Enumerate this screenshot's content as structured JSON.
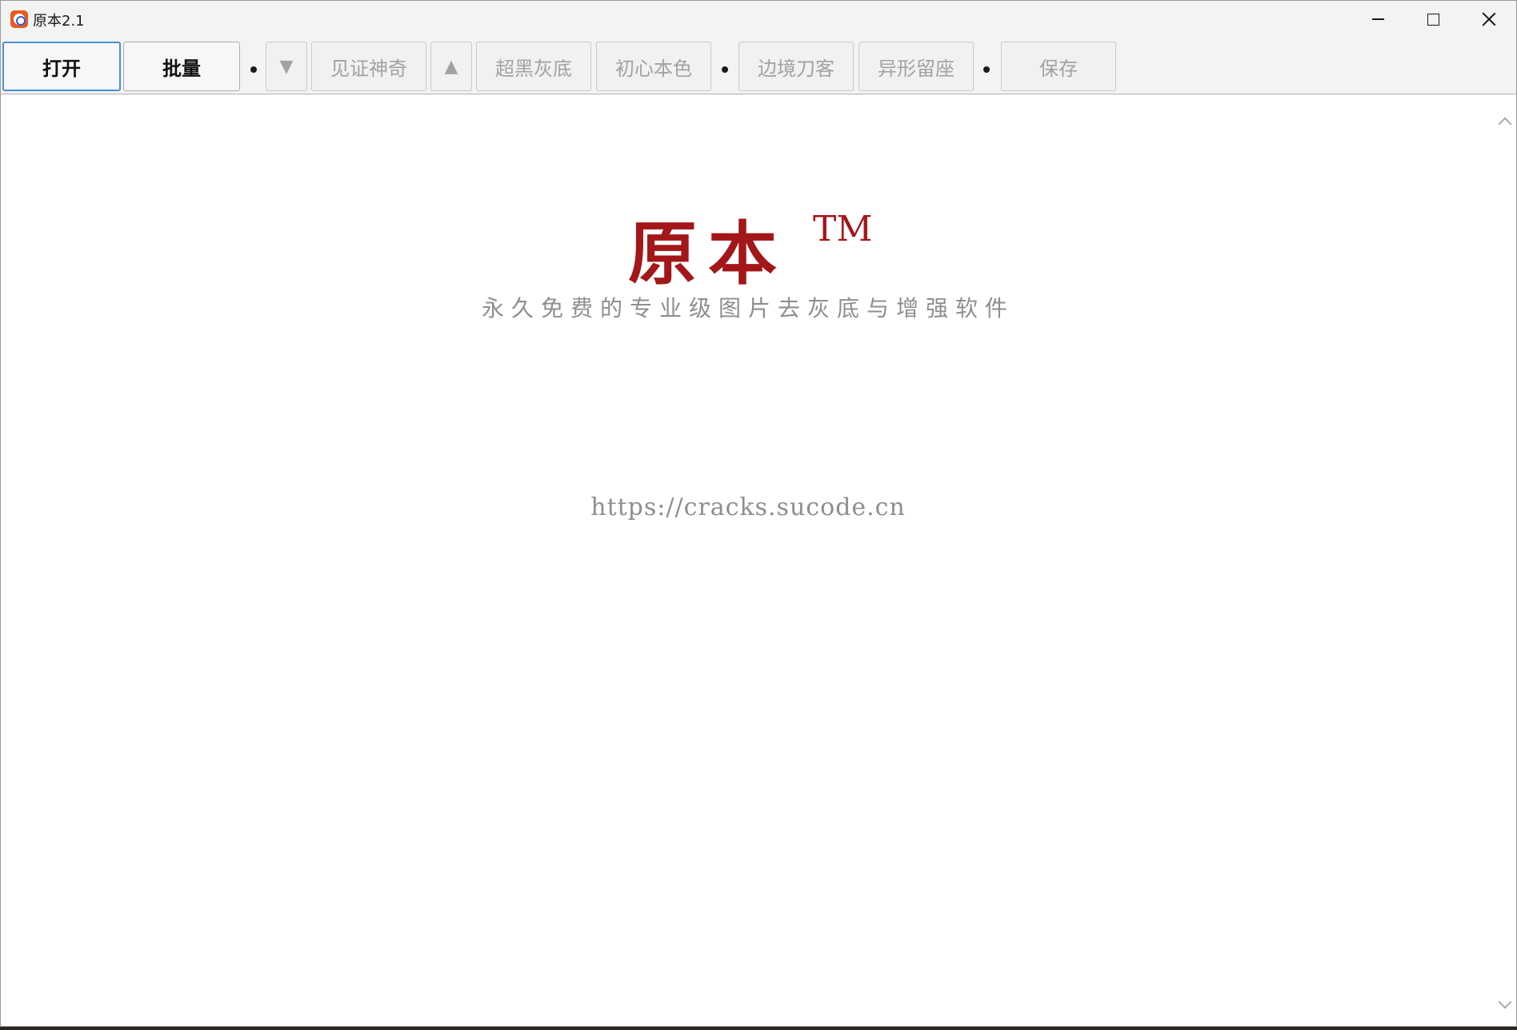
{
  "window": {
    "title": "原本2.1",
    "controls": {
      "minimize": "minimize-icon",
      "maximize": "maximize-icon",
      "close": "close-icon"
    }
  },
  "toolbar": {
    "open_label": "打开",
    "batch_label": "批量",
    "down_arrow": "▼",
    "magic_label": "见证神奇",
    "up_arrow": "▲",
    "superblack_label": "超黑灰底",
    "original_label": "初心本色",
    "border_label": "边境刀客",
    "irregular_label": "异形留座",
    "save_label": "保存"
  },
  "main": {
    "logo_text": "原本",
    "logo_tm": "TM",
    "tagline": "永久免费的专业级图片去灰底与增强软件",
    "url": "https://cracks.sucode.cn"
  },
  "colors": {
    "accent": "#a3161a",
    "focus_border": "#4a8fd8",
    "muted_text": "#8e8e8e"
  }
}
